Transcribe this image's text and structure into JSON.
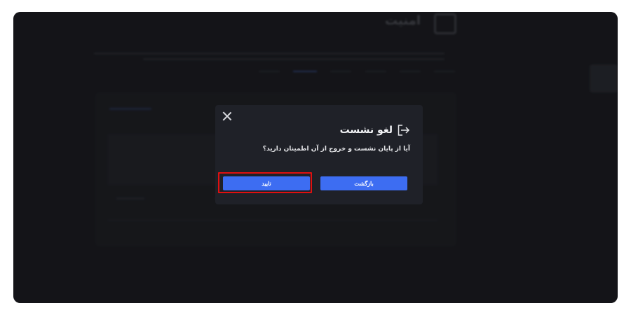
{
  "background_page": {
    "title": "امنیت",
    "link_label": "",
    "section_label": "",
    "tabs": [
      "",
      "",
      "",
      "",
      "",
      ""
    ]
  },
  "dialog": {
    "title": "لغو نشست",
    "message": "آیا از پایان نشست و خروج از آن اطمینان دارید؟",
    "back_label": "بازگشت",
    "confirm_label": "تایید"
  },
  "colors": {
    "accent": "#3d6df2",
    "highlight": "#e01010",
    "dialog_bg": "#1f2128"
  },
  "icons": {
    "close": "close-icon",
    "logout": "logout-icon",
    "lock": "lock-icon"
  }
}
